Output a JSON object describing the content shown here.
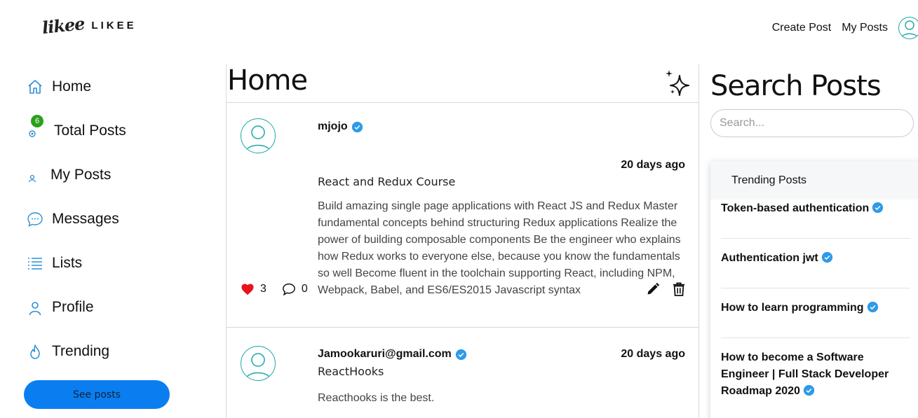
{
  "brand": {
    "script": "likee",
    "name": "LIKEE"
  },
  "topnav": {
    "create_post": "Create Post",
    "my_posts": "My Posts"
  },
  "sidebar": {
    "items": [
      {
        "label": "Home",
        "icon": "home-icon"
      },
      {
        "label": "Total Posts",
        "icon": "posts-icon",
        "badge": "6"
      },
      {
        "label": "My Posts",
        "icon": "user-small-icon"
      },
      {
        "label": "Messages",
        "icon": "chat-bubble-icon"
      },
      {
        "label": "Lists",
        "icon": "list-icon"
      },
      {
        "label": "Profile",
        "icon": "user-icon"
      },
      {
        "label": "Trending",
        "icon": "flame-icon"
      }
    ],
    "see_posts": "See posts"
  },
  "main": {
    "title": "Home",
    "posts": [
      {
        "author": "mjojo",
        "time": "20 days ago",
        "title": "React and Redux Course",
        "body": "Build amazing single page applications with React JS and Redux Master fundamental concepts behind structuring Redux applications Realize the power of building composable components Be the engineer who explains how Redux works to everyone else, because you know the fundamentals so well Become fluent in the toolchain supporting React, including NPM, Webpack, Babel, and ES6/ES2015 Javascript syntax",
        "likes": "3",
        "comments": "0"
      },
      {
        "author": "Jamookaruri@gmail.com",
        "time": "20 days ago",
        "title": "ReactHooks",
        "body": "Reacthooks is the best."
      }
    ]
  },
  "search": {
    "title": "Search Posts",
    "placeholder": "Search..."
  },
  "trending": {
    "heading": "Trending Posts",
    "items": [
      "Token-based authentication",
      "Authentication jwt",
      "How to learn programming",
      "How to become a Software Engineer | Full Stack Developer Roadmap 2020"
    ]
  },
  "colors": {
    "accent_blue": "#0a7ef0",
    "icon_blue": "#2b8fd6",
    "avatar_teal": "#1aa7a7",
    "like_red": "#e8121b",
    "badge_green": "#2ca01c",
    "verified_blue": "#2f9ae8"
  }
}
